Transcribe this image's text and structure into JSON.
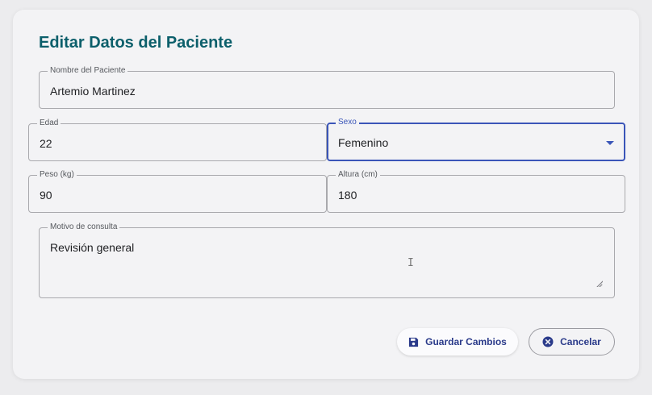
{
  "dialog": {
    "title": "Editar Datos del Paciente"
  },
  "fields": {
    "nombre": {
      "label": "Nombre del Paciente",
      "value": "Artemio Martinez"
    },
    "edad": {
      "label": "Edad",
      "value": "22"
    },
    "sexo": {
      "label": "Sexo",
      "value": "Femenino"
    },
    "peso": {
      "label": "Peso (kg)",
      "value": "90"
    },
    "altura": {
      "label": "Altura (cm)",
      "value": "180"
    },
    "motivo": {
      "label": "Motivo de consulta",
      "value": "Revisión general"
    }
  },
  "actions": {
    "save_label": "Guardar Cambios",
    "save_icon": "save-icon",
    "cancel_label": "Cancelar",
    "cancel_icon": "cancel-circle-icon"
  },
  "colors": {
    "title": "#0c5f6b",
    "accent": "#3a55b8",
    "button_text": "#2a3a8a"
  }
}
